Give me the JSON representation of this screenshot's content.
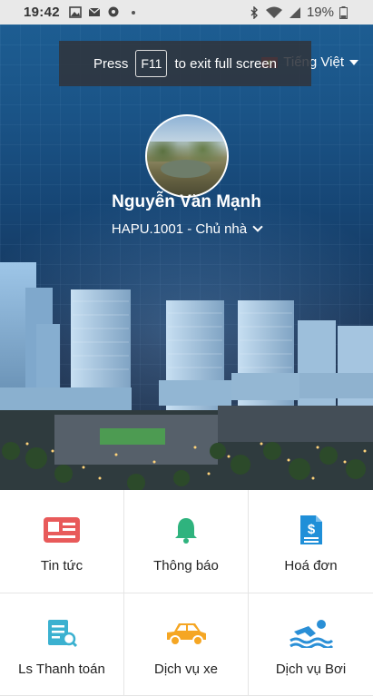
{
  "status_bar": {
    "time": "19:42",
    "battery": "19%"
  },
  "fullscreen_toast": {
    "press": "Press",
    "key": "F11",
    "message": "to exit full screen"
  },
  "language": {
    "label": "Tiếng Việt"
  },
  "profile": {
    "name": "Nguyễn Văn Mạnh",
    "role": "HAPU.1001 - Chủ nhà"
  },
  "menu": [
    {
      "label": "Tin tức",
      "icon": "news-icon",
      "color": "#e85a5a"
    },
    {
      "label": "Thông báo",
      "icon": "bell-icon",
      "color": "#2fb37e"
    },
    {
      "label": "Hoá đơn",
      "icon": "invoice-icon",
      "color": "#1f8fd8"
    },
    {
      "label": "Ls Thanh toán",
      "icon": "payment-history-icon",
      "color": "#3bb1d0"
    },
    {
      "label": "Dịch vụ xe",
      "icon": "car-icon",
      "color": "#f5a623"
    },
    {
      "label": "Dịch vụ Bơi",
      "icon": "swimming-icon",
      "color": "#2a8fd6"
    }
  ]
}
